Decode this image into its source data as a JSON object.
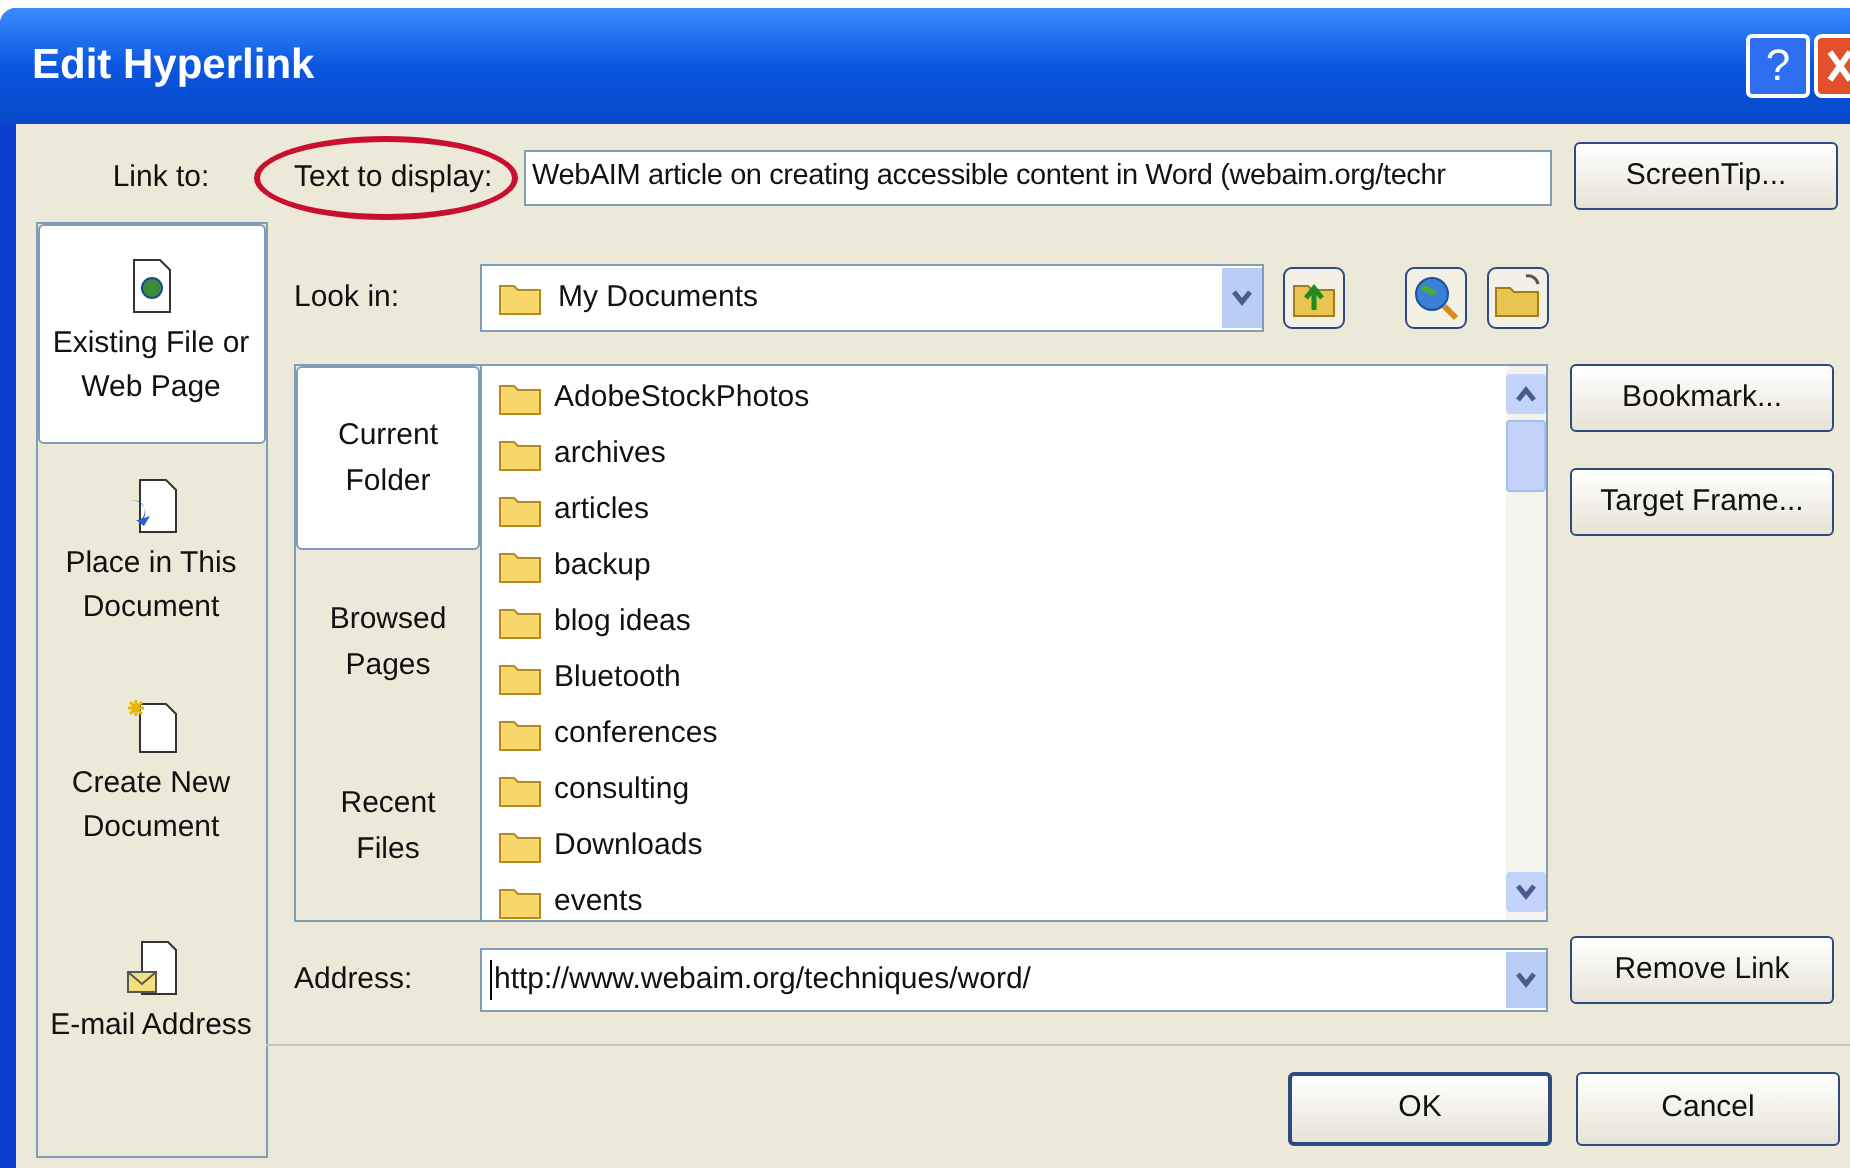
{
  "window": {
    "title": "Edit Hyperlink",
    "controls": [
      "?"
    ]
  },
  "link_to": {
    "label": "Link to:",
    "items": [
      {
        "label": "Existing File or Web Page",
        "kind": "web",
        "selected": true
      },
      {
        "label": "Place in This Document",
        "kind": "place",
        "selected": false
      },
      {
        "label": "Create New Document",
        "kind": "new",
        "selected": false
      },
      {
        "label": "E-mail Address",
        "kind": "email",
        "selected": false
      }
    ]
  },
  "text_to_display": {
    "label": "Text to display:",
    "circled": true,
    "value": "WebAIM article on creating accessible content in Word (webaim.org/techr"
  },
  "look_in": {
    "label": "Look in:",
    "value": "My Documents"
  },
  "sources": [
    {
      "label": "Current Folder",
      "selected": true
    },
    {
      "label": "Browsed Pages",
      "selected": false
    },
    {
      "label": "Recent Files",
      "selected": false
    }
  ],
  "files": [
    "AdobeStockPhotos",
    "archives",
    "articles",
    "backup",
    "blog ideas",
    "Bluetooth",
    "conferences",
    "consulting",
    "Downloads",
    "events"
  ],
  "address": {
    "label": "Address:",
    "value": "http://www.webaim.org/techniques/word/"
  },
  "side_buttons": [
    "ScreenTip...",
    "Bookmark...",
    "Target Frame...",
    "Remove Link"
  ],
  "buttons": [
    "OK",
    "Cancel"
  ]
}
